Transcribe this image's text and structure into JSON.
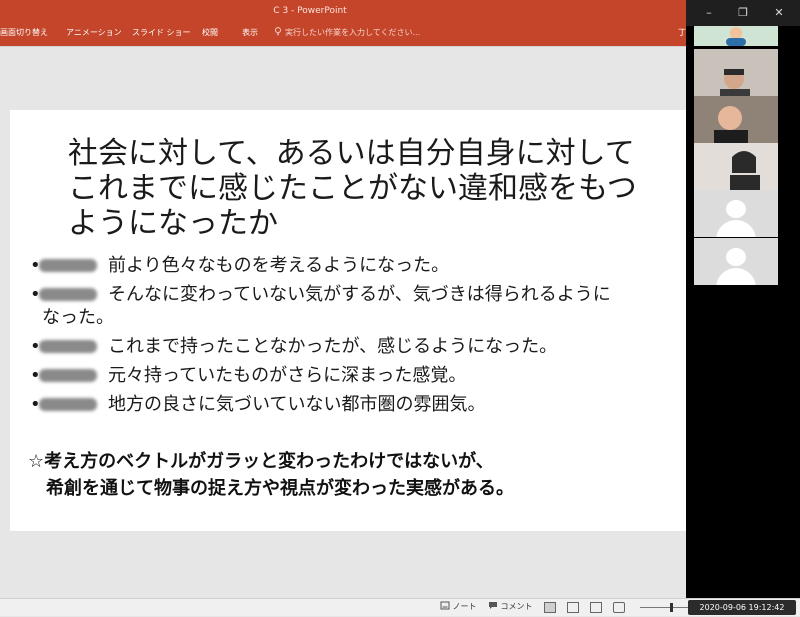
{
  "window": {
    "title": "C 3 - PowerPoint"
  },
  "ribbon": {
    "tabs": [
      "画面切り替え",
      "アニメーション",
      "スライド ショー",
      "校閲",
      "表示"
    ],
    "tell_me": "実行したい作業を入力してください...",
    "user": "丁"
  },
  "slide": {
    "title_lines": [
      "社会に対して、あるいは自分自身に対して",
      "これまでに感じたことがない違和感をもつ",
      "ようになったか"
    ],
    "bullets": [
      {
        "text": "前より色々なものを考えるようになった。"
      },
      {
        "text": "そんなに変わっていない気がするが、気づきは得られるように",
        "cont": "なった。"
      },
      {
        "text": "これまで持ったことなかったが、感じるようになった。"
      },
      {
        "text": "元々持っていたものがさらに深まった感覚。"
      },
      {
        "text": "地方の良さに気づいていない都市圏の雰囲気。"
      }
    ],
    "summary_lines": [
      "☆考え方のベクトルがガラッと変わったわけではないが、",
      "　希創を通じて物事の捉え方や視点が変わった実感がある。"
    ]
  },
  "status": {
    "notes": "ノート",
    "comments": "コメント",
    "timestamp": "2020-09-06 19:12:42"
  },
  "zoom": {
    "controls": [
      "–",
      "❐",
      "✕"
    ],
    "participants": [
      "participant-1",
      "participant-2",
      "participant-3",
      "participant-4",
      "participant-5",
      "participant-6"
    ]
  },
  "colors": {
    "ribbon": "#c4452a",
    "panel": "#000000",
    "avatar_bg": "#dcdcdc"
  }
}
